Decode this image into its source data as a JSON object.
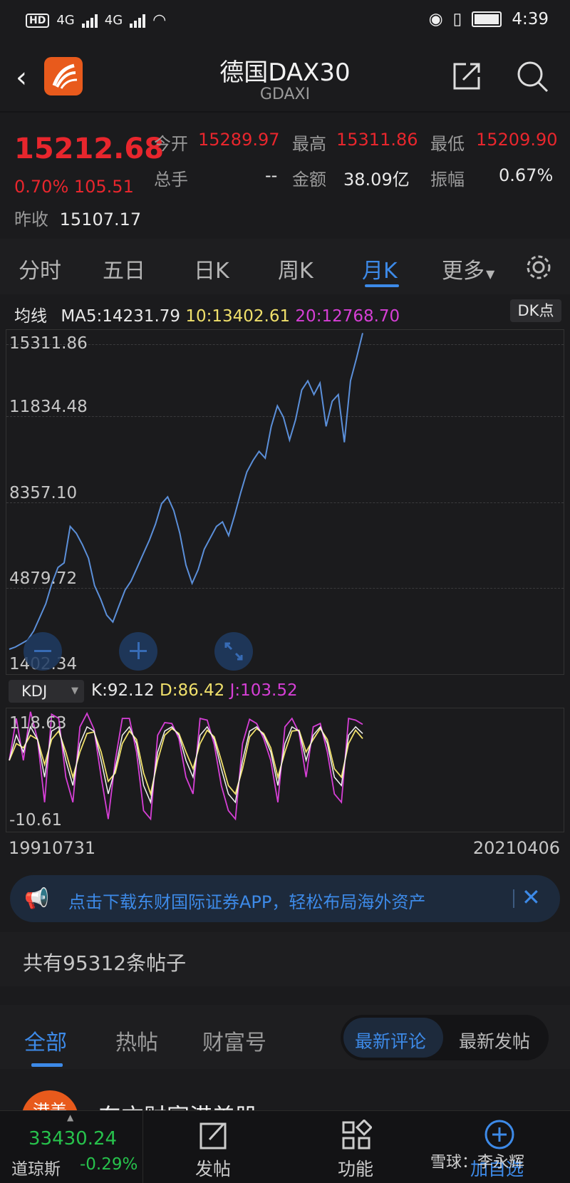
{
  "status": {
    "time": "4:39",
    "net1": "4G",
    "net2": "4G"
  },
  "header": {
    "title": "德国DAX30",
    "subtitle": "GDAXI"
  },
  "quote": {
    "price": "15212.68",
    "change": "0.70% 105.51",
    "prev_label": "昨收",
    "prev_value": "15107.17",
    "open_label": "今开",
    "open_value": "15289.97",
    "high_label": "最高",
    "high_value": "15311.86",
    "low_label": "最低",
    "low_value": "15209.90",
    "volume_label": "总手",
    "volume_value": "--",
    "amount_label": "金额",
    "amount_value": "38.09亿",
    "amp_label": "振幅",
    "amp_value": "0.67%"
  },
  "tabs": [
    "分时",
    "五日",
    "日K",
    "周K",
    "月K",
    "更多"
  ],
  "active_tab": "月K",
  "ma": {
    "label": "均线",
    "ma5": "MA5:14231.79",
    "ma10": "10:13402.61",
    "ma20": "20:12768.70",
    "dk": "DK点"
  },
  "y_ticks": [
    "15311.86",
    "11834.48",
    "8357.10",
    "4879.72",
    "1402.34"
  ],
  "kdj": {
    "selector": "KDJ",
    "k": "K:92.12",
    "d": "D:86.42",
    "j": "J:103.52",
    "top": "118.63",
    "bottom": "-10.61"
  },
  "dates": {
    "start": "19910731",
    "end": "20210406"
  },
  "banner": {
    "text": "点击下载东财国际证券APP，轻松布局海外资产"
  },
  "posts": {
    "count_text": "共有95312条帖子"
  },
  "post_tabs": [
    "全部",
    "热帖",
    "财富号"
  ],
  "post_sort": [
    "最新评论",
    "最新发帖"
  ],
  "feed_preview": {
    "avatar_text": "港美",
    "author": "东方财富港美股"
  },
  "footer": {
    "index_value": "33430.24",
    "index_name": "道琼斯",
    "index_change": "-0.29%",
    "post_label": "发帖",
    "func_label": "功能",
    "add_label": "加自选",
    "watermark": "雪球：李永辉"
  },
  "colors": {
    "up": "#e8262d",
    "accent": "#3d8ae8",
    "ma10": "#f0e06b",
    "ma20": "#d63fd6",
    "price_line": "#5b8fd9",
    "down": "#27c24c"
  },
  "chart_data": [
    {
      "type": "line",
      "title": "",
      "x_range": [
        "19910731",
        "20210406"
      ],
      "y_ticks": [
        15311.86,
        11834.48,
        8357.1,
        4879.72,
        1402.34
      ],
      "ylim": [
        1402.34,
        15311.86
      ],
      "series": [
        {
          "values": [
            1402,
            1500,
            1650,
            1800,
            2200,
            2800,
            3400,
            4300,
            5000,
            5200,
            6800,
            6500,
            6000,
            5400,
            4200,
            3600,
            2900,
            2600,
            3300,
            4000,
            4400,
            5000,
            5600,
            6200,
            6900,
            7800,
            8100,
            7500,
            6500,
            5100,
            4300,
            4900,
            5800,
            6300,
            6800,
            7000,
            6400,
            7300,
            8300,
            9200,
            9700,
            10100,
            9800,
            11200,
            12100,
            11600,
            10600,
            11500,
            12800,
            13200,
            12600,
            13100,
            11200,
            12300,
            12600,
            10500,
            13200,
            14200,
            15300
          ]
        }
      ]
    },
    {
      "type": "line",
      "title": "",
      "ylim": [
        -10.61,
        118.63
      ],
      "series": [
        {
          "name": "K",
          "values": [
            60,
            90,
            70,
            100,
            85,
            40,
            95,
            100,
            60,
            30,
            80,
            100,
            95,
            60,
            20,
            50,
            90,
            100,
            80,
            30,
            10,
            70,
            95,
            100,
            90,
            60,
            40,
            90,
            100,
            85,
            50,
            20,
            10,
            60,
            95,
            100,
            90,
            70,
            30,
            80,
            100,
            95,
            60,
            90,
            100,
            80,
            40,
            30,
            90,
            100,
            92
          ]
        },
        {
          "name": "D",
          "values": [
            60,
            80,
            75,
            90,
            85,
            55,
            85,
            95,
            70,
            40,
            70,
            92,
            94,
            70,
            35,
            45,
            80,
            95,
            85,
            45,
            20,
            60,
            90,
            98,
            92,
            70,
            50,
            80,
            96,
            88,
            60,
            30,
            20,
            50,
            88,
            98,
            92,
            75,
            40,
            70,
            95,
            96,
            70,
            85,
            98,
            85,
            50,
            40,
            80,
            96,
            86
          ]
        },
        {
          "name": "J",
          "values": [
            60,
            110,
            60,
            118,
            85,
            10,
            115,
            110,
            40,
            10,
            100,
            116,
            97,
            40,
            -10,
            60,
            110,
            110,
            70,
            0,
            -10,
            90,
            105,
            104,
            86,
            40,
            20,
            110,
            108,
            79,
            30,
            0,
            -10,
            80,
            109,
            104,
            86,
            60,
            10,
            100,
            110,
            93,
            40,
            100,
            104,
            70,
            20,
            10,
            110,
            108,
            103
          ]
        }
      ]
    }
  ]
}
